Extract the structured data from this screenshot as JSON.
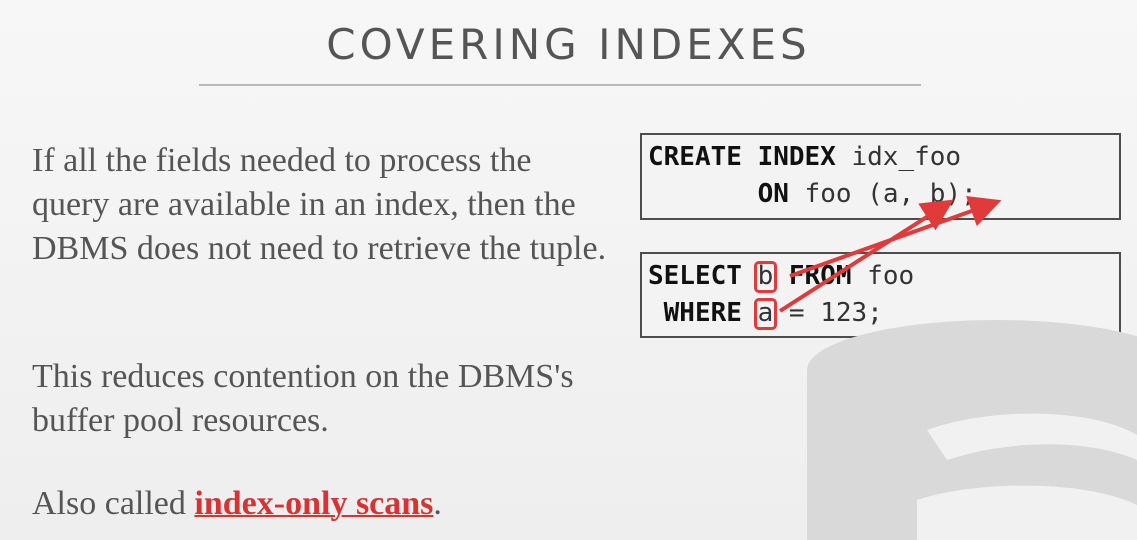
{
  "slide": {
    "title": "COVERING INDEXES",
    "paragraph1": "If all the fields needed to process the query are available in an index, then the DBMS does not need to retrieve the tuple.",
    "paragraph2": "This reduces contention on the DBMS's buffer pool resources.",
    "paragraph3_prefix": "Also called ",
    "paragraph3_term": "index-only scans",
    "paragraph3_suffix": "."
  },
  "code": {
    "create": {
      "kw1": "CREATE INDEX",
      "name": " idx_foo",
      "indent": "       ",
      "kw2": "ON",
      "table": " foo (",
      "col_a": "a",
      "sep": ", ",
      "col_b": "b",
      "end": ");"
    },
    "select": {
      "kw1": "SELECT",
      "space1": " ",
      "col_b": "b",
      "space2": " ",
      "kw2": "FROM",
      "table": " foo",
      "indent": " ",
      "kw3": "WHERE",
      "space3": " ",
      "col_a": "a",
      "cond": " = 123;"
    }
  },
  "colors": {
    "accent": "#e03a3a",
    "text": "#555555",
    "term": "#d63434"
  },
  "icons": {
    "watermark": "database-icon",
    "arrows": "arrow-icon"
  }
}
